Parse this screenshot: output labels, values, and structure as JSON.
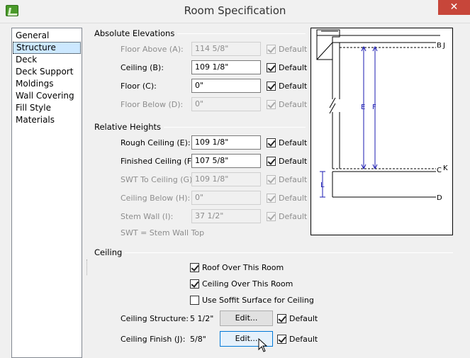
{
  "window": {
    "title": "Room Specification",
    "close_glyph": "✕"
  },
  "nav": {
    "items": [
      {
        "label": "General"
      },
      {
        "label": "Structure"
      },
      {
        "label": "Deck"
      },
      {
        "label": "Deck Support"
      },
      {
        "label": "Moldings"
      },
      {
        "label": "Wall Covering"
      },
      {
        "label": "Fill Style"
      },
      {
        "label": "Materials"
      }
    ],
    "selected": "Structure"
  },
  "absolute": {
    "heading": "Absolute Elevations",
    "floor_above": {
      "label": "Floor Above (A):",
      "value": "114 5/8\"",
      "default_label": "Default"
    },
    "ceiling": {
      "label": "Ceiling (B):",
      "value": "109 1/8\"",
      "default_label": "Default"
    },
    "floor": {
      "label": "Floor (C):",
      "value": "0\"",
      "default_label": "Default"
    },
    "floor_below": {
      "label": "Floor Below (D):",
      "value": "0\"",
      "default_label": "Default"
    }
  },
  "relative": {
    "heading": "Relative Heights",
    "rough_ceiling": {
      "label": "Rough Ceiling (E):",
      "value": "109 1/8\"",
      "default_label": "Default"
    },
    "finished_ceiling": {
      "label": "Finished Ceiling (F):",
      "value": "107 5/8\"",
      "default_label": "Default"
    },
    "swt_to_ceiling": {
      "label": "SWT To Ceiling (G):",
      "value": "109 1/8\"",
      "default_label": "Default"
    },
    "ceiling_below": {
      "label": "Ceiling Below (H):",
      "value": "0\"",
      "default_label": "Default"
    },
    "stem_wall": {
      "label": "Stem Wall (I):",
      "value": "37 1/2\"",
      "default_label": "Default"
    },
    "note": "SWT = Stem Wall Top"
  },
  "ceiling": {
    "heading": "Ceiling",
    "roof_over": "Roof Over This Room",
    "ceiling_over": "Ceiling Over This Room",
    "soffit": "Use Soffit Surface for Ceiling",
    "structure": {
      "label": "Ceiling Structure:",
      "value": "5 1/2\"",
      "button": "Edit...",
      "default_label": "Default"
    },
    "finish": {
      "label": "Ceiling Finish (J):",
      "value": "5/8\"",
      "button": "Edit...",
      "default_label": "Default"
    }
  },
  "diagram": {
    "labels": {
      "B": "B",
      "J": "J",
      "E": "E",
      "F": "F",
      "C": "C",
      "K": "K",
      "L": "L",
      "D": "D"
    }
  }
}
